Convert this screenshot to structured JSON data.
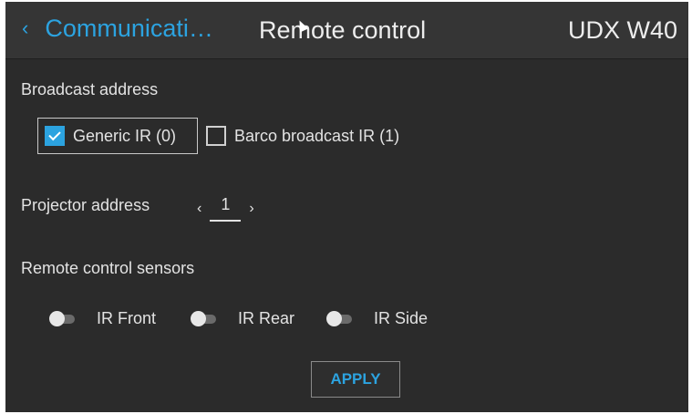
{
  "header": {
    "back_label": "Communicati…",
    "title": "Remote control",
    "model": "UDX W40"
  },
  "broadcast": {
    "label": "Broadcast address",
    "options": [
      {
        "label": "Generic IR (0)",
        "checked": true
      },
      {
        "label": "Barco broadcast IR (1)",
        "checked": false
      }
    ]
  },
  "projector_address": {
    "label": "Projector address",
    "value": "1"
  },
  "sensors": {
    "label": "Remote control sensors",
    "items": [
      {
        "label": "IR Front",
        "on": false
      },
      {
        "label": "IR Rear",
        "on": false
      },
      {
        "label": "IR Side",
        "on": false
      }
    ]
  },
  "apply_label": "APPLY",
  "colors": {
    "accent": "#2ca3e0",
    "background": "#2b2b2b",
    "header": "#353535"
  }
}
